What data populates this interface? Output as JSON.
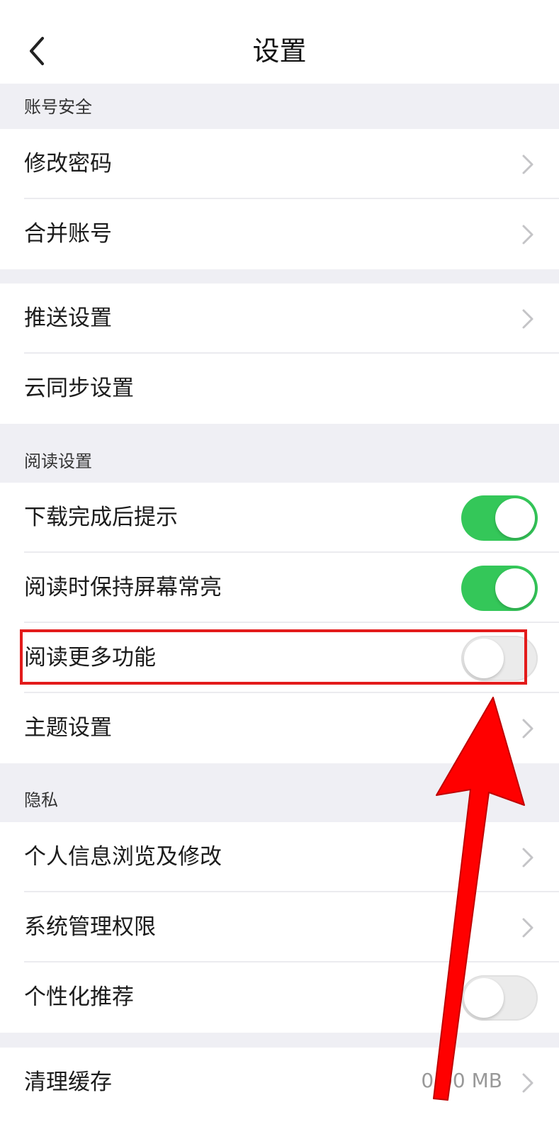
{
  "header": {
    "title": "设置"
  },
  "sections": {
    "account_security": "账号安全",
    "reading_settings": "阅读设置",
    "privacy": "隐私"
  },
  "rows": {
    "change_password": "修改密码",
    "merge_account": "合并账号",
    "push_settings": "推送设置",
    "cloud_sync": "云同步设置",
    "download_notify": "下载完成后提示",
    "keep_screen_on": "阅读时保持屏幕常亮",
    "more_reading_features": "阅读更多功能",
    "theme_settings": "主题设置",
    "personal_info": "个人信息浏览及修改",
    "system_permissions": "系统管理权限",
    "personalized_recommend": "个性化推荐",
    "clear_cache": "清理缓存"
  },
  "cache": {
    "size": "0.00 MB"
  },
  "toggles": {
    "download_notify": true,
    "keep_screen_on": true,
    "more_reading_features": false,
    "personalized_recommend": false
  },
  "colors": {
    "toggle_on": "#34c759",
    "highlight": "#e31b1b",
    "arrow": "#ff0000"
  }
}
